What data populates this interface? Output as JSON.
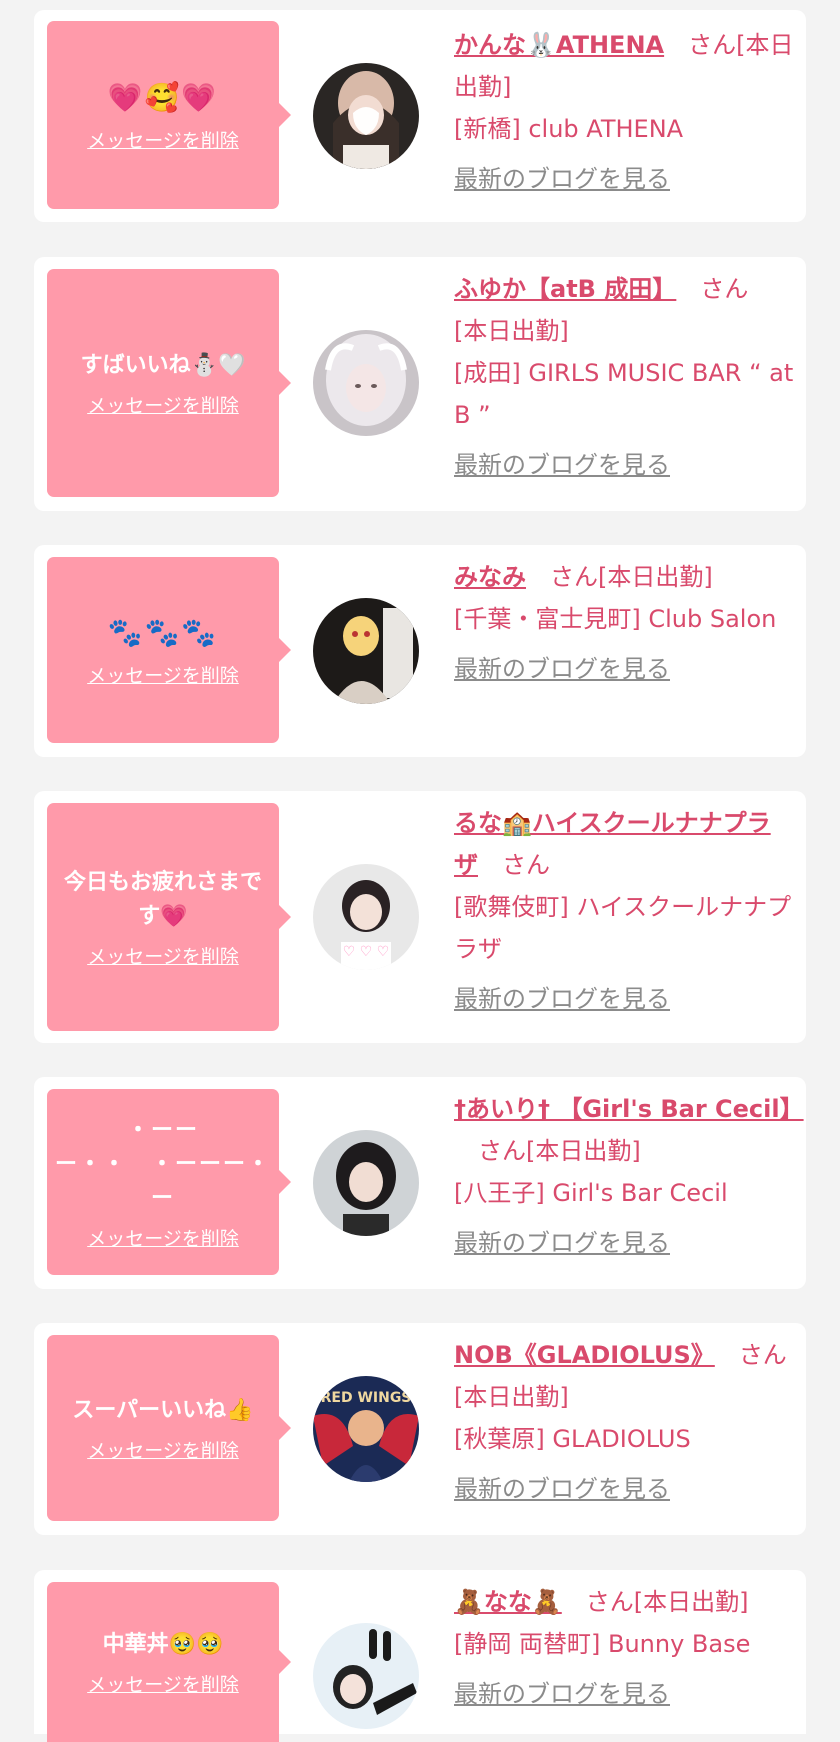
{
  "delete_label": "メッセージを削除",
  "blog_label": "最新のブログを見る",
  "items": [
    {
      "message": "💗🥰💗",
      "name": "かんな🐰ATHENA",
      "suffix": "さん",
      "status": "[本日出勤]",
      "shop": "[新橋] club ATHENA"
    },
    {
      "message": "すばいいね⛄🤍",
      "name": "ふゆか【atB 成田】",
      "suffix": "さん",
      "status": "[本日出勤]",
      "shop": "[成田] GIRLS MUSIC BAR “ at B ”"
    },
    {
      "message": "🐾🐾🐾",
      "name": "みなみ",
      "suffix": "さん",
      "status": "[本日出勤]",
      "shop": "[千葉・富士見町] Club Salon"
    },
    {
      "message": "今日もお疲れさまです💗",
      "name": "るな🏫ハイスクールナナプラザ",
      "suffix": "さん",
      "status": "",
      "shop": "[歌舞伎町] ハイスクールナナプラザ"
    },
    {
      "message_lines": [
        "・ーー",
        "ー・・　・ーーー・",
        "ー"
      ],
      "name": "†あいり† 【Girl's Bar Cecil】",
      "suffix": "さん",
      "status": "[本日出勤]",
      "shop": "[八王子] Girl's Bar Cecil"
    },
    {
      "message": "スーパーいいね👍",
      "name": "NOB《GLADIOLUS》",
      "suffix": "さん",
      "status": "[本日出勤]",
      "shop": "[秋葉原] GLADIOLUS"
    },
    {
      "message": "中華丼🥹🥹",
      "name": "🧸なな🧸",
      "suffix": "さん",
      "status": "[本日出勤]",
      "shop": "[静岡 両替町] Bunny Base"
    }
  ]
}
